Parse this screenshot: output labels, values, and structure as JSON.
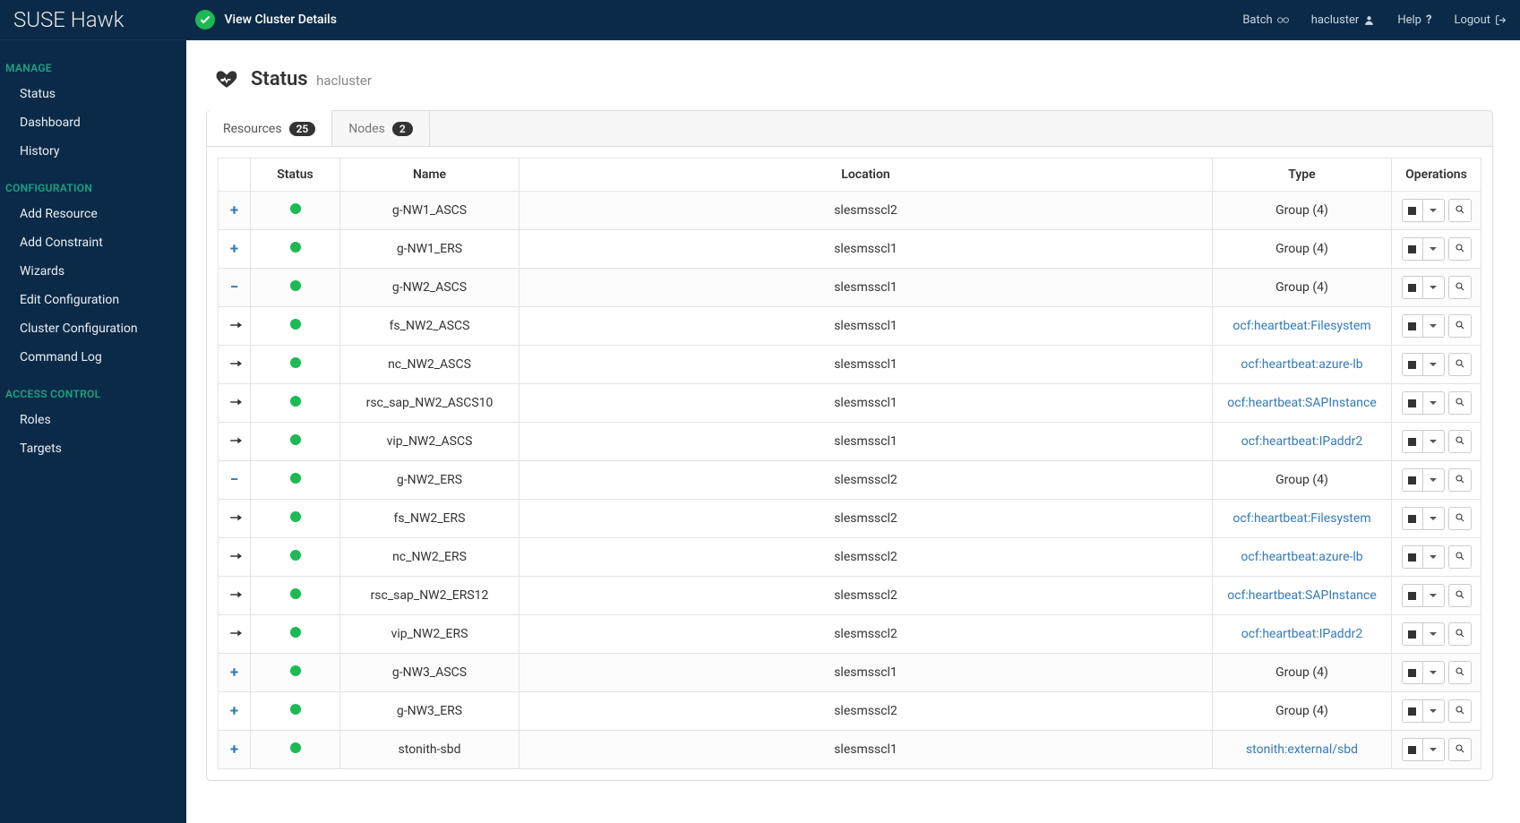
{
  "topbar": {
    "brand": "SUSE Hawk",
    "view_cluster": "View Cluster Details",
    "batch": "Batch",
    "user": "hacluster",
    "help": "Help",
    "logout": "Logout"
  },
  "sidebar": {
    "sections": [
      {
        "heading": "MANAGE",
        "items": [
          "Status",
          "Dashboard",
          "History"
        ]
      },
      {
        "heading": "CONFIGURATION",
        "items": [
          "Add Resource",
          "Add Constraint",
          "Wizards",
          "Edit Configuration",
          "Cluster Configuration",
          "Command Log"
        ]
      },
      {
        "heading": "ACCESS CONTROL",
        "items": [
          "Roles",
          "Targets"
        ]
      }
    ]
  },
  "page": {
    "title": "Status",
    "subtitle": "hacluster"
  },
  "tabs": {
    "resources": {
      "label": "Resources",
      "count": "25"
    },
    "nodes": {
      "label": "Nodes",
      "count": "2"
    }
  },
  "table": {
    "headers": {
      "status": "Status",
      "name": "Name",
      "location": "Location",
      "type": "Type",
      "operations": "Operations"
    },
    "rows": [
      {
        "expand": "plus",
        "name": "g-NW1_ASCS",
        "location": "slesmsscl2",
        "type": "Group (4)",
        "type_link": false,
        "child": false
      },
      {
        "expand": "plus",
        "name": "g-NW1_ERS",
        "location": "slesmsscl1",
        "type": "Group (4)",
        "type_link": false,
        "child": false
      },
      {
        "expand": "minus",
        "name": "g-NW2_ASCS",
        "location": "slesmsscl1",
        "type": "Group (4)",
        "type_link": false,
        "child": false
      },
      {
        "expand": "arrow",
        "name": "fs_NW2_ASCS",
        "location": "slesmsscl1",
        "type": "ocf:heartbeat:Filesystem",
        "type_link": true,
        "child": true
      },
      {
        "expand": "arrow",
        "name": "nc_NW2_ASCS",
        "location": "slesmsscl1",
        "type": "ocf:heartbeat:azure-lb",
        "type_link": true,
        "child": true
      },
      {
        "expand": "arrow",
        "name": "rsc_sap_NW2_ASCS10",
        "location": "slesmsscl1",
        "type": "ocf:heartbeat:SAPInstance",
        "type_link": true,
        "child": true
      },
      {
        "expand": "arrow",
        "name": "vip_NW2_ASCS",
        "location": "slesmsscl1",
        "type": "ocf:heartbeat:IPaddr2",
        "type_link": true,
        "child": true
      },
      {
        "expand": "minus",
        "name": "g-NW2_ERS",
        "location": "slesmsscl2",
        "type": "Group (4)",
        "type_link": false,
        "child": false
      },
      {
        "expand": "arrow",
        "name": "fs_NW2_ERS",
        "location": "slesmsscl2",
        "type": "ocf:heartbeat:Filesystem",
        "type_link": true,
        "child": true
      },
      {
        "expand": "arrow",
        "name": "nc_NW2_ERS",
        "location": "slesmsscl2",
        "type": "ocf:heartbeat:azure-lb",
        "type_link": true,
        "child": true
      },
      {
        "expand": "arrow",
        "name": "rsc_sap_NW2_ERS12",
        "location": "slesmsscl2",
        "type": "ocf:heartbeat:SAPInstance",
        "type_link": true,
        "child": true
      },
      {
        "expand": "arrow",
        "name": "vip_NW2_ERS",
        "location": "slesmsscl2",
        "type": "ocf:heartbeat:IPaddr2",
        "type_link": true,
        "child": true
      },
      {
        "expand": "plus",
        "name": "g-NW3_ASCS",
        "location": "slesmsscl1",
        "type": "Group (4)",
        "type_link": false,
        "child": false
      },
      {
        "expand": "plus",
        "name": "g-NW3_ERS",
        "location": "slesmsscl2",
        "type": "Group (4)",
        "type_link": false,
        "child": false
      },
      {
        "expand": "plus",
        "name": "stonith-sbd",
        "location": "slesmsscl1",
        "type": "stonith:external/sbd",
        "type_link": true,
        "child": false
      }
    ]
  }
}
